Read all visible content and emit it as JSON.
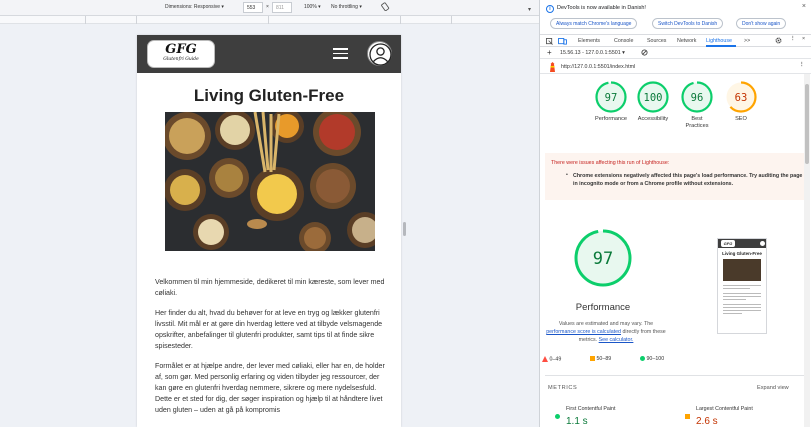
{
  "device_toolbar": {
    "dimensions_label": "Dimensions: Responsive ▾",
    "width": "553",
    "times": "×",
    "height": "811",
    "zoom": "100% ▾",
    "throttling": "No throttling ▾",
    "rotate_icon": "rotate-icon",
    "collapse_arrow": "▾"
  },
  "site": {
    "logo_main": "GFG",
    "logo_sub": "Glutenfri Guide",
    "title": "Living Gluten-Free",
    "paragraphs": [
      "Velkommen til min hjemmeside, dedikeret til min kæreste, som lever med cøliaki.",
      "Her finder du alt, hvad du behøver for at leve en tryg og lækker glutenfri livsstil. Mit mål er at gøre din hverdag lettere ved at tilbyde velsmagende opskrifter, anbefalinger til glutenfri produkter, samt tips til at finde sikre spisesteder.",
      "Formålet er at hjælpe andre, der lever med cøliaki, eller har en, de holder af, som gør. Med personlig erfaring og viden tilbyder jeg ressourcer, der kan gøre en glutenfri hverdag nemmere, sikrere og mere nydelsesfuld. Dette er et sted for dig, der søger inspiration og hjælp til at håndtere livet uden gluten – uden at gå på kompromis"
    ]
  },
  "devtools": {
    "notice_text": "DevTools is now available in Danish!",
    "btn_always": "Always match Chrome's language",
    "btn_switch": "Switch DevTools to Danish",
    "btn_dont": "Don't show again",
    "close": "×",
    "tabs": {
      "elements": "Elements",
      "console": "Console",
      "sources": "Sources",
      "network": "Network",
      "lighthouse": "Lighthouse",
      "more": ">>"
    },
    "run_label": "15.56.13 - 127.0.0.1:5501 ▾",
    "url": "http://127.0.0.1:5501/index.html",
    "scores": [
      {
        "value": "97",
        "label": "Performance",
        "status": "pass"
      },
      {
        "value": "100",
        "label": "Accessibility",
        "status": "pass"
      },
      {
        "value": "96",
        "label": "Best Practices",
        "status": "pass"
      },
      {
        "value": "63",
        "label": "SEO",
        "status": "average"
      }
    ],
    "issues_title": "There were issues affecting this run of Lighthouse:",
    "issues_item": "Chrome extensions negatively affected this page's load performance. Try auditing the page in incognito mode or from a Chrome profile without extensions.",
    "perf_score": "97",
    "perf_label": "Performance",
    "perf_desc_a": "Values are estimated and may vary. The",
    "perf_desc_link1": "performance score is calculated",
    "perf_desc_b": "directly from these metrics.",
    "perf_desc_link2": "See calculator.",
    "legend": {
      "fail": "0–49",
      "average": "50–89",
      "pass": "90–100"
    },
    "metrics_heading": "METRICS",
    "expand_view": "Expand view",
    "metrics": [
      {
        "name": "First Contentful Paint",
        "value": "1.1 s",
        "status": "pass"
      },
      {
        "name": "Largest Contentful Paint",
        "value": "2.6 s",
        "status": "average"
      }
    ],
    "thumb_logo": "GFG",
    "thumb_title": "Living Gluten-Free"
  },
  "colors": {
    "pass": "#0cce6b",
    "pass_text": "#0a7a3a",
    "average": "#ffa400",
    "average_text": "#c33300",
    "fail": "#ff4e42",
    "link": "#1a73e8"
  }
}
